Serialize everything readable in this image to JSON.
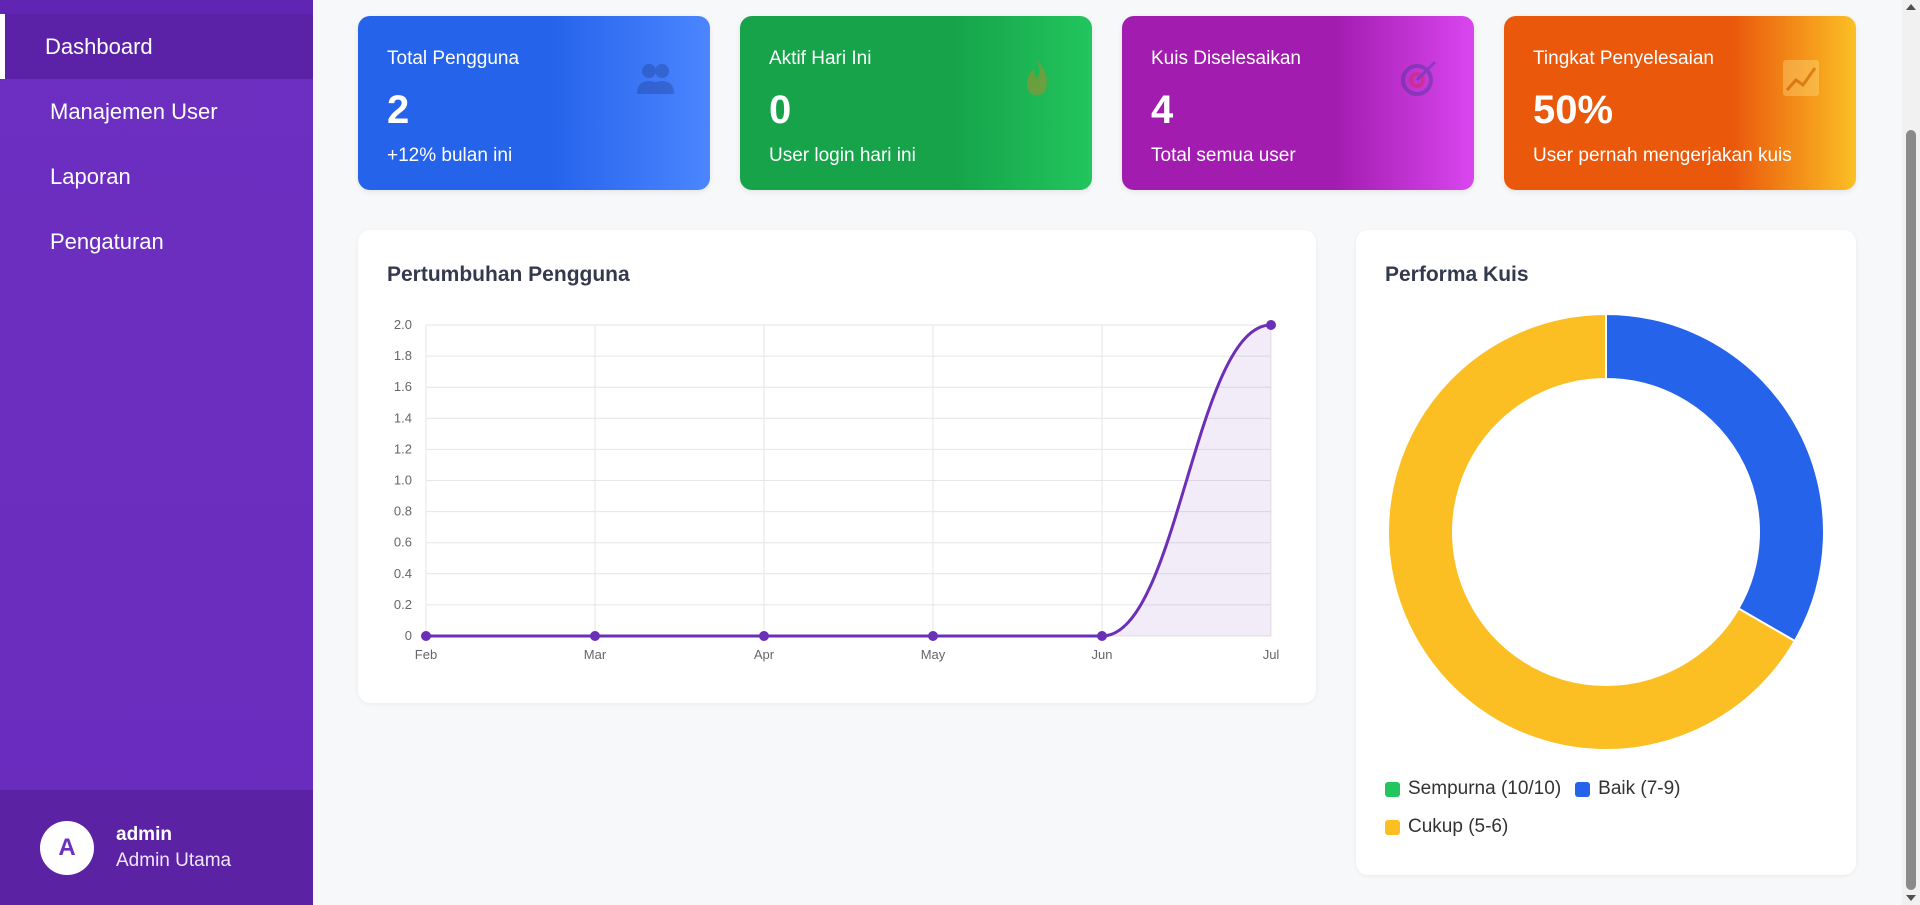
{
  "sidebar": {
    "items": [
      {
        "label": "Dashboard",
        "active": true
      },
      {
        "label": "Manajemen User"
      },
      {
        "label": "Laporan"
      },
      {
        "label": "Pengaturan"
      }
    ],
    "user": {
      "avatar_letter": "A",
      "name": "admin",
      "role": "Admin Utama"
    },
    "color": "#6d2fc0"
  },
  "cards": [
    {
      "label": "Total Pengguna",
      "value": "2",
      "sub": "+12% bulan ini",
      "icon": "users-icon",
      "color": "#2563eb"
    },
    {
      "label": "Aktif Hari Ini",
      "value": "0",
      "sub": "User login hari ini",
      "icon": "fire-icon",
      "color": "#16a34a"
    },
    {
      "label": "Kuis Diselesaikan",
      "value": "4",
      "sub": "Total semua user",
      "icon": "target-icon",
      "color": "#a21caf"
    },
    {
      "label": "Tingkat Penyelesaian",
      "value": "50%",
      "sub": "User pernah mengerjakan kuis",
      "icon": "chart-up-icon",
      "color": "#ea580c"
    }
  ],
  "line_panel": {
    "title": "Pertumbuhan Pengguna"
  },
  "donut_panel": {
    "title": "Performa Kuis"
  },
  "chart_data": [
    {
      "type": "line",
      "title": "Pertumbuhan Pengguna",
      "x": [
        "Feb",
        "Mar",
        "Apr",
        "May",
        "Jun",
        "Jul"
      ],
      "series": [
        {
          "values": [
            0,
            0,
            0,
            0,
            0,
            2
          ]
        }
      ],
      "ylim": [
        0,
        2
      ],
      "yticks": [
        "2.0",
        "1.8",
        "1.6",
        "1.4",
        "1.2",
        "1.0",
        "0.8",
        "0.6",
        "0.4",
        "0.2",
        "0"
      ],
      "grid": true,
      "color": "#6b2fb8"
    },
    {
      "type": "pie",
      "title": "Performa Kuis",
      "categories": [
        "Sempurna (10/10)",
        "Baik (7-9)",
        "Cukup (5-6)"
      ],
      "values": [
        0,
        1,
        2
      ],
      "colors": [
        "#22c55e",
        "#2563eb",
        "#fbbf24"
      ],
      "legend": "bottom"
    }
  ]
}
